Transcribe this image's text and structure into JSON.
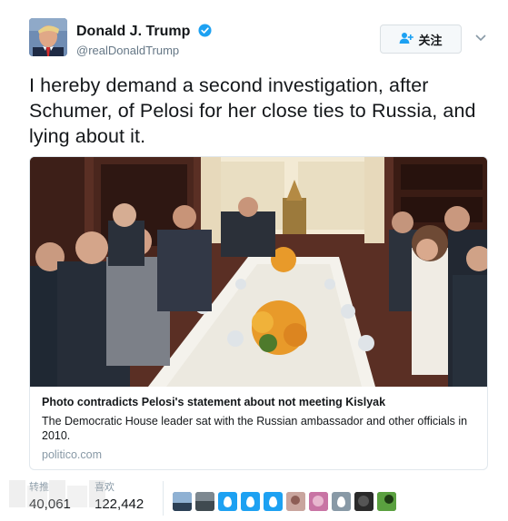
{
  "user": {
    "display_name": "Donald J. Trump",
    "handle": "@realDonaldTrump",
    "verified_icon": "verified-badge-icon"
  },
  "follow_button": {
    "label": "关注",
    "icon": "add-user-icon"
  },
  "tweet": {
    "text": "I hereby demand a second investigation, after Schumer, of Pelosi for her close ties to Russia, and lying about it."
  },
  "card": {
    "title": "Photo contradicts Pelosi's statement about not meeting Kislyak",
    "description": "The Democratic House leader sat with the Russian ambassador and other officials in 2010.",
    "domain": "politico.com"
  },
  "stats": {
    "retweets_label": "转推",
    "retweets_value": "40,061",
    "likes_label": "喜欢",
    "likes_value": "122,442"
  },
  "likers": {
    "count": 10
  },
  "colors": {
    "accent": "#1da1f2",
    "text": "#14171a",
    "secondary": "#657786",
    "border": "#e1e8ed"
  }
}
